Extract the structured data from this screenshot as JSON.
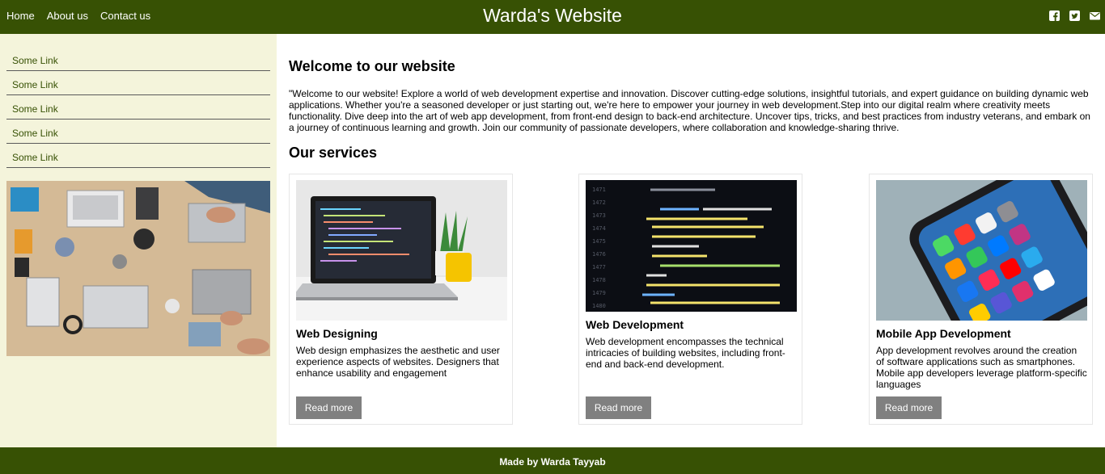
{
  "header": {
    "title": "Warda's Website",
    "nav": [
      "Home",
      "About us",
      "Contact us"
    ],
    "social_icons": [
      "facebook-icon",
      "twitter-icon",
      "email-icon"
    ]
  },
  "sidebar": {
    "links": [
      "Some Link",
      "Some Link",
      "Some Link",
      "Some Link",
      "Some Link"
    ]
  },
  "main": {
    "welcome_title": "Welcome to our website",
    "intro": "\"Welcome to our website! Explore a world of web development expertise and innovation. Discover cutting-edge solutions, insightful tutorials, and expert guidance on building dynamic web applications. Whether you're a seasoned developer or just starting out, we're here to empower your journey in web development.Step into our digital realm where creativity meets functionality. Dive deep into the art of web app development, from front-end design to back-end architecture. Uncover tips, tricks, and best practices from industry veterans, and embark on a journey of continuous learning and growth. Join our community of passionate developers, where collaboration and knowledge-sharing thrive.",
    "services_title": "Our services",
    "cards": [
      {
        "title": "Web Designing",
        "text": "Web design emphasizes the aesthetic and user experience aspects of websites. Designers that enhance usability and engagement",
        "button": "Read more"
      },
      {
        "title": "Web Development",
        "text": "Web development encompasses the technical intricacies of building websites, including front-end and back-end development.",
        "button": "Read more"
      },
      {
        "title": "Mobile App Development",
        "text": "App development revolves around the creation of software applications such as smartphones. Mobile app developers leverage platform-specific languages",
        "button": "Read more"
      }
    ]
  },
  "footer": {
    "text": "Made by Warda Tayyab"
  },
  "colors": {
    "header_bg": "#375104",
    "sidebar_bg": "#f4f4db",
    "button_bg": "#808080"
  }
}
